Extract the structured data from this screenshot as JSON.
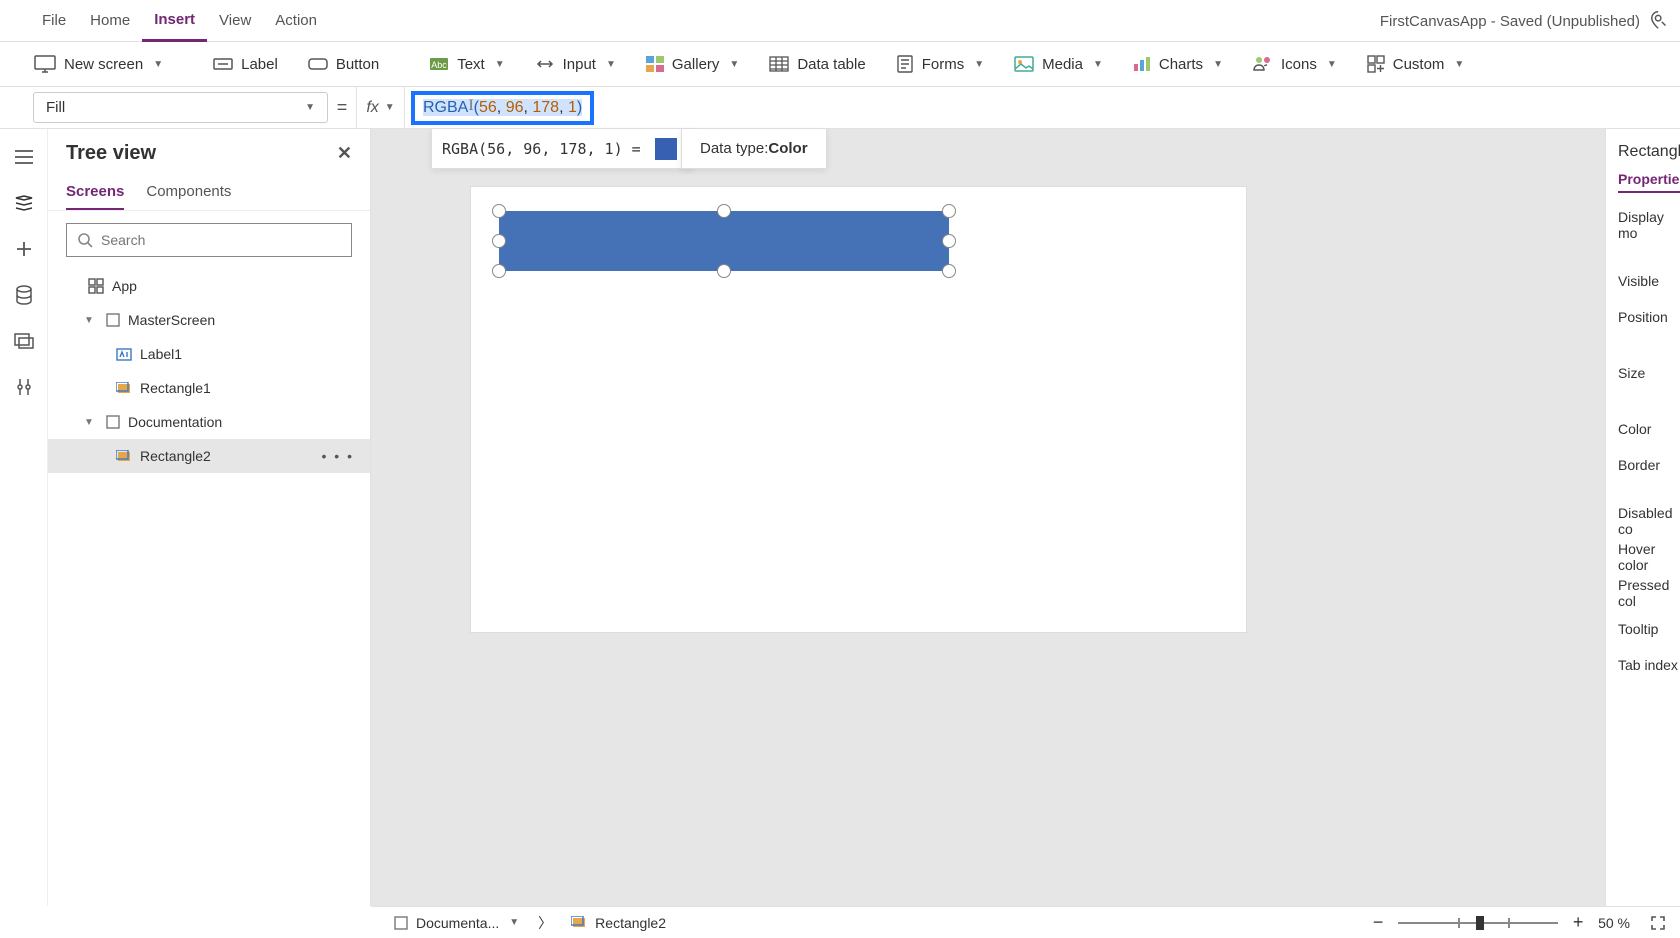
{
  "app": {
    "title": "FirstCanvasApp - Saved (Unpublished)"
  },
  "menu": {
    "file": "File",
    "home": "Home",
    "insert": "Insert",
    "view": "View",
    "action": "Action"
  },
  "ribbon": {
    "new_screen": "New screen",
    "label": "Label",
    "button": "Button",
    "text": "Text",
    "input": "Input",
    "gallery": "Gallery",
    "data_table": "Data table",
    "forms": "Forms",
    "media": "Media",
    "charts": "Charts",
    "icons": "Icons",
    "custom": "Custom"
  },
  "formula": {
    "property": "Fill",
    "fx": "fx",
    "fn": "RGBA",
    "args": [
      "56",
      "96",
      "178",
      "1"
    ],
    "result_label": "RGBA(56, 96, 178, 1)  =",
    "result_color": "#3860b2",
    "datatype_label": "Data type: ",
    "datatype_value": "Color"
  },
  "treeview": {
    "title": "Tree view",
    "tab_screens": "Screens",
    "tab_components": "Components",
    "search_placeholder": "Search",
    "app": "App",
    "items": [
      {
        "name": "MasterScreen",
        "children": [
          {
            "name": "Label1"
          },
          {
            "name": "Rectangle1"
          }
        ]
      },
      {
        "name": "Documentation",
        "children": [
          {
            "name": "Rectangle2",
            "selected": true
          }
        ]
      }
    ]
  },
  "properties": {
    "title": "Rectangle",
    "tab": "Properties",
    "rows": {
      "display_mode": "Display mo",
      "visible": "Visible",
      "position": "Position",
      "size": "Size",
      "color": "Color",
      "border": "Border",
      "disabled": "Disabled co",
      "hover": "Hover color",
      "pressed": "Pressed col",
      "tooltip": "Tooltip",
      "tab_index": "Tab index"
    }
  },
  "status": {
    "screen": "Documenta...",
    "control": "Rectangle2",
    "zoom": "50  %"
  }
}
